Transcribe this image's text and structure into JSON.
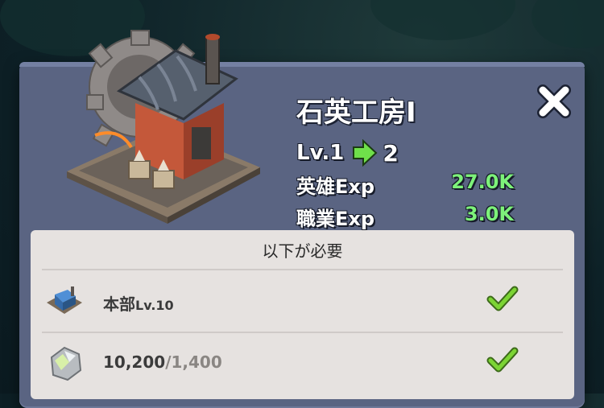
{
  "building": {
    "name": "石英工房Ⅰ",
    "level_label": "Lv.1",
    "level_next": "2"
  },
  "stats": [
    {
      "label": "英雄Exp",
      "value": "27.0K"
    },
    {
      "label": "職業Exp",
      "value": "3.0K"
    }
  ],
  "requirements": {
    "header": "以下が必要",
    "items": [
      {
        "label": "本部",
        "level": "Lv.10",
        "icon": "headquarters-icon",
        "met": true
      },
      {
        "have": "10,200",
        "sep": "/",
        "need": "1,400",
        "icon": "quartz-icon",
        "met": true
      }
    ]
  },
  "colors": {
    "panel": "#5a6482",
    "card": "#e6e2e0",
    "exp_value": "#7df27a",
    "check": "#7cd434"
  }
}
